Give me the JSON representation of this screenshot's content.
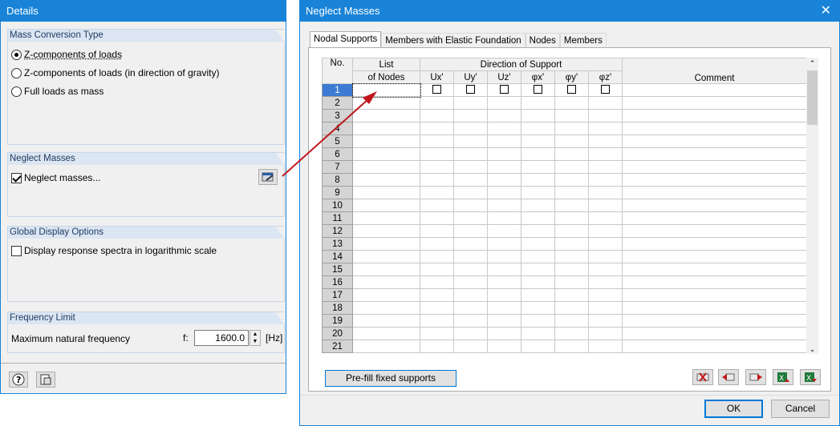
{
  "details": {
    "title": "Details",
    "mass_conversion": {
      "header": "Mass Conversion Type",
      "options": [
        {
          "label": "Z-components of loads",
          "selected": true
        },
        {
          "label": "Z-components of loads (in direction of gravity)",
          "selected": false
        },
        {
          "label": "Full loads as mass",
          "selected": false
        }
      ]
    },
    "neglect_masses": {
      "header": "Neglect Masses",
      "checkbox_label": "Neglect masses...",
      "checked": true,
      "edit_icon": "edit-dialog-icon"
    },
    "global_display": {
      "header": "Global Display Options",
      "checkbox_label": "Display response spectra in logarithmic scale",
      "checked": false
    },
    "frequency_limit": {
      "header": "Frequency Limit",
      "label": "Maximum natural frequency",
      "symbol": "f:",
      "value": "1600.0",
      "unit": "[Hz]"
    },
    "footer_icons": [
      "help-icon",
      "units-icon"
    ]
  },
  "neglect": {
    "title": "Neglect Masses",
    "tabs": [
      "Nodal Supports",
      "Members with Elastic Foundation",
      "Nodes",
      "Members"
    ],
    "active_tab": 0,
    "table": {
      "col_no": "No.",
      "col_list_1": "List",
      "col_list_2": "of Nodes",
      "group_header": "Direction of Support",
      "dir_cols": [
        "Ux'",
        "Uy'",
        "Uz'",
        "φx'",
        "φy'",
        "φz'"
      ],
      "col_comment": "Comment",
      "rows": [
        "1",
        "2",
        "3",
        "4",
        "5",
        "6",
        "7",
        "8",
        "9",
        "10",
        "11",
        "12",
        "13",
        "14",
        "15",
        "16",
        "17",
        "18",
        "19",
        "20",
        "21"
      ],
      "selected_row": 0
    },
    "prefill_button": "Pre-fill fixed supports",
    "table_tools": [
      "delete-row-icon",
      "insert-row-before-icon",
      "insert-row-after-icon",
      "export-excel-icon",
      "import-excel-icon"
    ],
    "ok_label": "OK",
    "cancel_label": "Cancel"
  },
  "colors": {
    "titlebar": "#1883d7",
    "arrow": "#c0161b",
    "selected_row": "#3b7bd3"
  }
}
